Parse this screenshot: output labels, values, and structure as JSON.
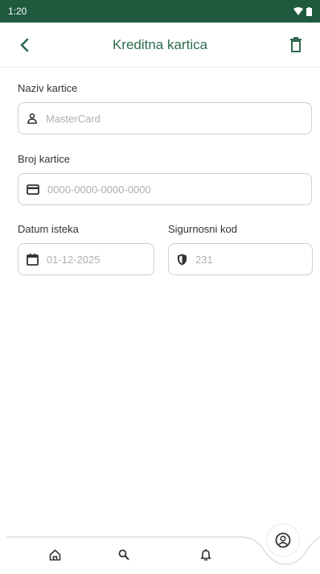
{
  "status_bar": {
    "time": "1:20"
  },
  "app_bar": {
    "title": "Kreditna kartica"
  },
  "form": {
    "card_name": {
      "label": "Naziv kartice",
      "placeholder": "MasterCard"
    },
    "card_number": {
      "label": "Broj kartice",
      "placeholder": "0000-0000-0000-0000"
    },
    "expiry": {
      "label": "Datum isteka",
      "placeholder": "01-12-2025"
    },
    "cvv": {
      "label": "Sigurnosni kod",
      "placeholder": "231"
    }
  },
  "colors": {
    "accent": "#2e6b4e",
    "status_bar": "#1f5a3f"
  },
  "icons": {
    "back": "chevron-left-icon",
    "delete": "trash-icon",
    "card_name": "person-icon",
    "card_number": "credit-card-icon",
    "expiry": "calendar-icon",
    "cvv": "shield-icon",
    "nav_home": "home-icon",
    "nav_search": "search-icon",
    "nav_notifications": "bell-icon",
    "nav_profile": "profile-icon"
  }
}
